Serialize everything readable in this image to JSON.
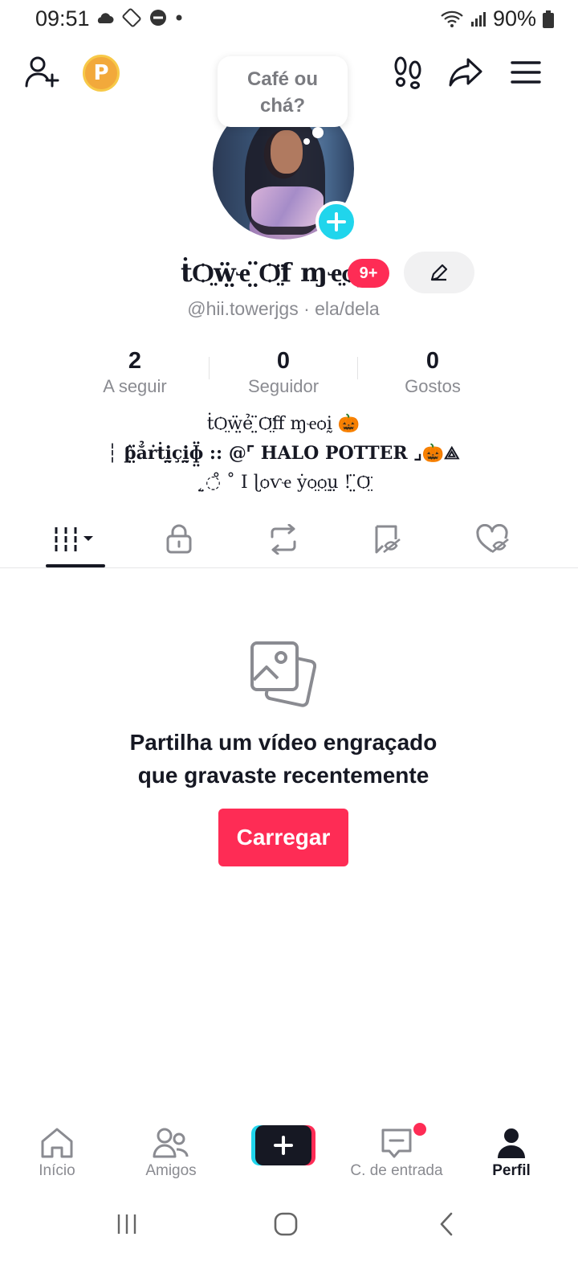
{
  "status_bar": {
    "time": "09:51",
    "battery": "90%"
  },
  "bubble": {
    "line1": "Café ou",
    "line2": "chá?"
  },
  "profile": {
    "display_name": "ṫѺ̤ẅ̤ҽ ̤̈Ѻ̤̈f ɱҽ̤ѻḭ",
    "notification_badge": "9+",
    "handle": "@hii.towerjgs · ela/dela"
  },
  "stats": [
    {
      "value": "2",
      "label": "A seguir"
    },
    {
      "value": "0",
      "label": "Seguidor"
    },
    {
      "value": "0",
      "label": "Gostos"
    }
  ],
  "bio": {
    "line1": "ṫѺ̤ẅ̤ẻ ̤̈Ѻ̤̈ff ɱҽѻḭ 🎃",
    "line2": "┆ ƥ̤̈ẳṙṫḭ̤ҫḭ̤ɸ̤̈ :: @⌜ HALO POTTER ⌟🎃⟁",
    "line3": "˛̤◌̊ ˚ I ɭѻѵҽ ẏѻ̤ѻ̤ṳ ! ̤̈Ѻ̤̈"
  },
  "tabs": [
    {
      "icon": "videos-grid-icon",
      "active": true
    },
    {
      "icon": "lock-icon",
      "active": false
    },
    {
      "icon": "repost-icon",
      "active": false
    },
    {
      "icon": "saved-icon",
      "active": false
    },
    {
      "icon": "liked-icon",
      "active": false
    }
  ],
  "empty_state": {
    "line1": "Partilha um vídeo engraçado",
    "line2": "que gravaste recentemente",
    "button": "Carregar"
  },
  "bottom_nav": {
    "home": "Início",
    "friends": "Amigos",
    "inbox": "C. de entrada",
    "profile": "Perfil"
  },
  "colors": {
    "accent": "#fe2c55",
    "cyan": "#20d5ec",
    "text": "#161823",
    "muted": "#8a8b91"
  }
}
